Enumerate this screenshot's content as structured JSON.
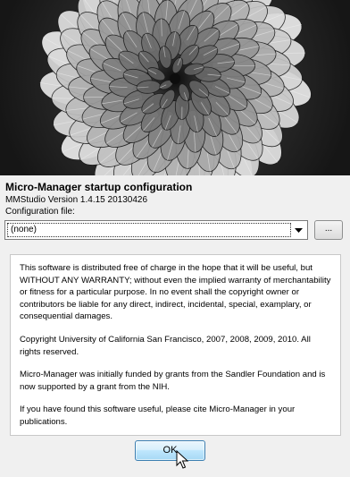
{
  "dialog": {
    "title": "Micro-Manager startup configuration",
    "version": "MMStudio Version 1.4.15  20130426",
    "config_label": "Configuration file:",
    "config_selected": "(none)",
    "browse_label": "...",
    "ok_label": "OK"
  },
  "license": {
    "paragraphs": [
      "This software is distributed free of charge in the hope that it will be useful, but WITHOUT ANY WARRANTY; without even the implied warranty of merchantability or fitness for a particular purpose. In no event shall the copyright owner or contributors be liable for any direct, indirect, incidental, special, examplary, or consequential damages.",
      "Copyright University of California San Francisco, 2007, 2008, 2009, 2010. All rights reserved.",
      "Micro-Manager was initially funded by grants from the Sandler Foundation and is now supported by a grant from the NIH.",
      "If you have found this software useful, please cite Micro-Manager in your publications."
    ]
  },
  "icons": {
    "dropdown": "chevron-down-icon",
    "cursor": "mouse-pointer-icon",
    "splash": "spiral-plant-photo"
  },
  "colors": {
    "window_bg": "#f0f0f0",
    "ok_border": "#3c7fb1",
    "ok_fill": "#bee6fd"
  }
}
